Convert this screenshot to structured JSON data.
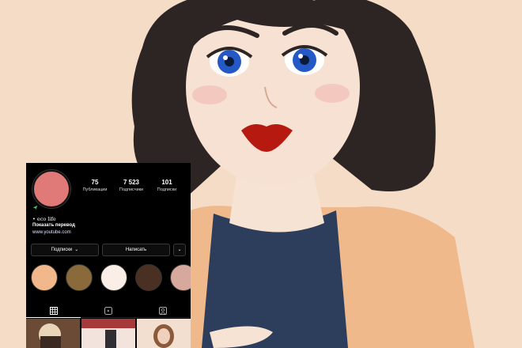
{
  "profile": {
    "stats": [
      {
        "value": "75",
        "label": "Публикации"
      },
      {
        "value": "7 523",
        "label": "Подписчики"
      },
      {
        "value": "101",
        "label": "Подписки"
      }
    ],
    "username": "",
    "bio": "• eco life",
    "translate_label": "Показать перевод",
    "website": "www.youtube.com"
  },
  "actions": {
    "follow_label": "Подписки",
    "message_label": "Написать"
  },
  "highlights": [
    {
      "color": "#f2b88c"
    },
    {
      "color": "#8a6a3a"
    },
    {
      "color": "#fbeee6"
    },
    {
      "color": "#4a2f23"
    },
    {
      "color": "#d7a89c"
    }
  ],
  "colors": {
    "background": "#f4dcc6",
    "avatar": "#e07a79",
    "panel": "#000000"
  },
  "icons": [
    "send-icon",
    "chevron-down-icon",
    "grid-icon",
    "reels-icon",
    "tagged-icon"
  ]
}
